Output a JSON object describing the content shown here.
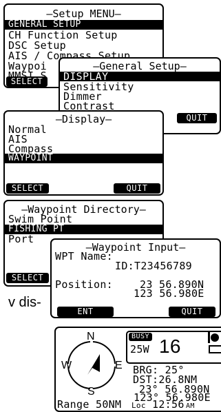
{
  "setup_menu": {
    "title": "–Setup MENU–",
    "items": [
      "GENERAL SETUP",
      "CH Function Setup",
      "DSC Setup",
      "AIS / Compass Setup",
      "Waypoi",
      "MMSI S"
    ],
    "select": "SELECT"
  },
  "general_setup": {
    "title": "–General Setup–",
    "items": [
      "DISPLAY",
      "Sensitivity",
      "Dimmer",
      "Contrast"
    ],
    "quit": "QUIT"
  },
  "display_menu": {
    "title": "–Display–",
    "items": [
      "Normal",
      "AIS",
      "Compass",
      "WAYPOINT"
    ],
    "select": "SELECT",
    "quit": "QUIT"
  },
  "waypoint_directory": {
    "title": "–Waypoint Directory–",
    "items": [
      "Swim Point",
      "FISHING PT",
      "Port"
    ],
    "select": "SELECT"
  },
  "waypoint_input": {
    "title": "–Waypoint Input–",
    "name_label": "WPT Name:",
    "id_label": "ID:",
    "id_value": "T23456789",
    "position_label": "Position:",
    "lat": "23 56.890N",
    "lon": "123 56.980E",
    "ent": "ENT",
    "quit": "QUIT"
  },
  "side_text": "v dis-",
  "compass_screen": {
    "n": "N",
    "s": "S",
    "e": "E",
    "w": "W",
    "range": "Range 50NM",
    "busy": "BUSY",
    "wind": "25W",
    "channel": "16",
    "brg": "BRG: 25°",
    "dst": "DST:26.8NM",
    "lat": "23° 56.890N",
    "lon": "123° 56.980E",
    "loc_label": "Loc",
    "time": "12:56",
    "ampm": "AM"
  }
}
